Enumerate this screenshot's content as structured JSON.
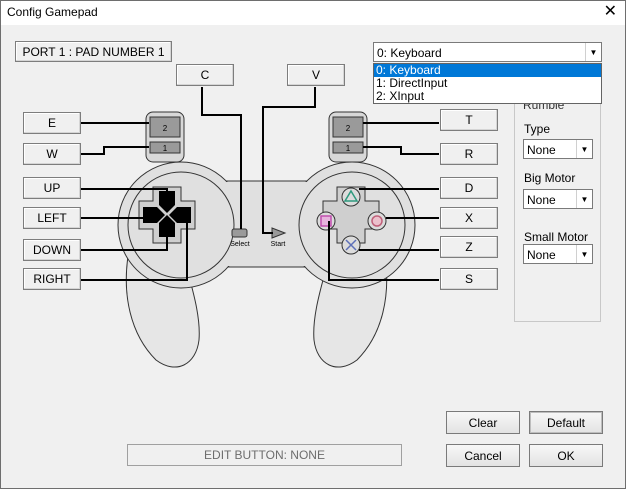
{
  "window": {
    "title": "Config Gamepad",
    "close_glyph": "✕"
  },
  "port_label": "PORT 1 : PAD NUMBER 1",
  "device_select": {
    "value": "0: Keyboard",
    "options": [
      "0: Keyboard",
      "1: DirectInput",
      "2: XInput"
    ]
  },
  "buttons": {
    "select_key": "C",
    "start_key": "V",
    "l2": "E",
    "l1": "W",
    "up": "UP",
    "left": "LEFT",
    "down": "DOWN",
    "right": "RIGHT",
    "r2": "T",
    "r1": "R",
    "triangle": "D",
    "circle": "X",
    "cross": "Z",
    "square": "S"
  },
  "pad_labels": {
    "select": "Select",
    "start": "Start",
    "l2": "2",
    "l1": "1",
    "r2": "2",
    "r1": "1"
  },
  "rumble": {
    "title": "Rumble",
    "type_label": "Type",
    "type_value": "None",
    "big_label": "Big Motor",
    "big_value": "None",
    "small_label": "Small Motor",
    "small_value": "None"
  },
  "edit_status": "EDIT BUTTON: NONE",
  "actions": {
    "clear": "Clear",
    "default": "Default",
    "cancel": "Cancel",
    "ok": "OK"
  },
  "colors": {
    "selection": "#0078d7",
    "triangle": "#2e9a7e",
    "circle": "#c0607a",
    "cross": "#5c6fb8",
    "square": "#c04fae"
  }
}
